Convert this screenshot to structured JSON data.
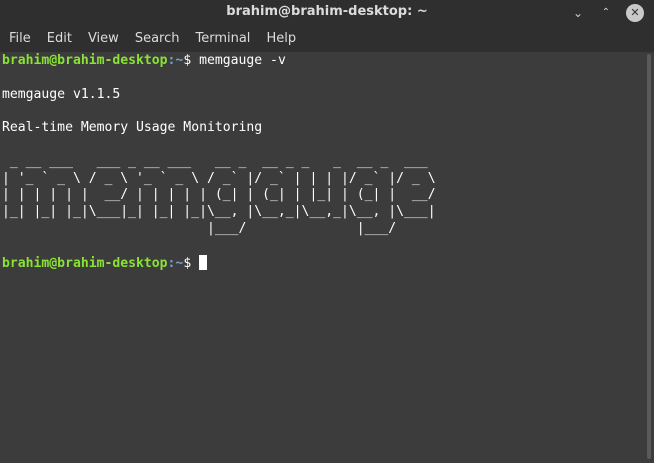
{
  "window": {
    "title": "brahim@brahim-desktop: ~",
    "minimize_glyph": "⌄",
    "maximize_glyph": "⌃",
    "close_glyph": "✕"
  },
  "menu": [
    "File",
    "Edit",
    "View",
    "Search",
    "Terminal",
    "Help"
  ],
  "terminal": {
    "prompt_user": "brahim@brahim-desktop",
    "prompt_path": ":~",
    "prompt_symbol": "$ ",
    "command": "memgauge -v",
    "output": [
      "",
      "memgauge v1.1.5",
      "",
      "Real-time Memory Usage Monitoring",
      "",
      " _ __ ___   ___ _ __ ___   __ _  __ _ _   _  __ _  ___ ",
      "| '_ ` _ \\ / _ \\ '_ ` _ \\ / _` |/ _` | | | |/ _` |/ _ \\",
      "| | | | | |  __/ | | | | | (_| | (_| | |_| | (_| |  __/",
      "|_| |_| |_|\\___|_| |_| |_|\\__, |\\__,_|\\__,_|\\__, |\\___|",
      "                          |___/              |___/     ",
      ""
    ]
  }
}
